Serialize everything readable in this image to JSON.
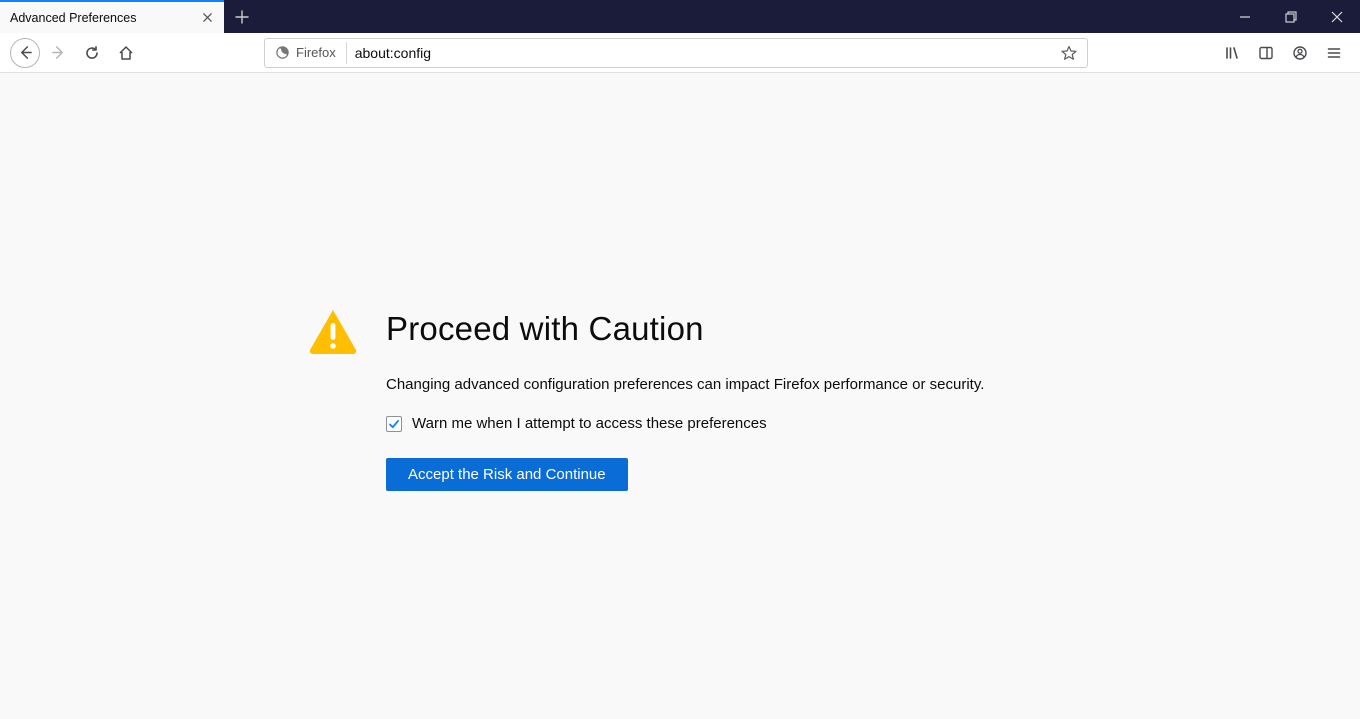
{
  "tab": {
    "title": "Advanced Preferences"
  },
  "urlbar": {
    "identity_label": "Firefox",
    "url": "about:config"
  },
  "warning": {
    "title": "Proceed with Caution",
    "description": "Changing advanced configuration preferences can impact Firefox performance or security.",
    "checkbox_label": "Warn me when I attempt to access these preferences",
    "checkbox_checked": true,
    "accept_label": "Accept the Risk and Continue"
  },
  "colors": {
    "accent": "#0a84ff",
    "warn_triangle": "#ffbf00",
    "button": "#0a6cd6"
  }
}
